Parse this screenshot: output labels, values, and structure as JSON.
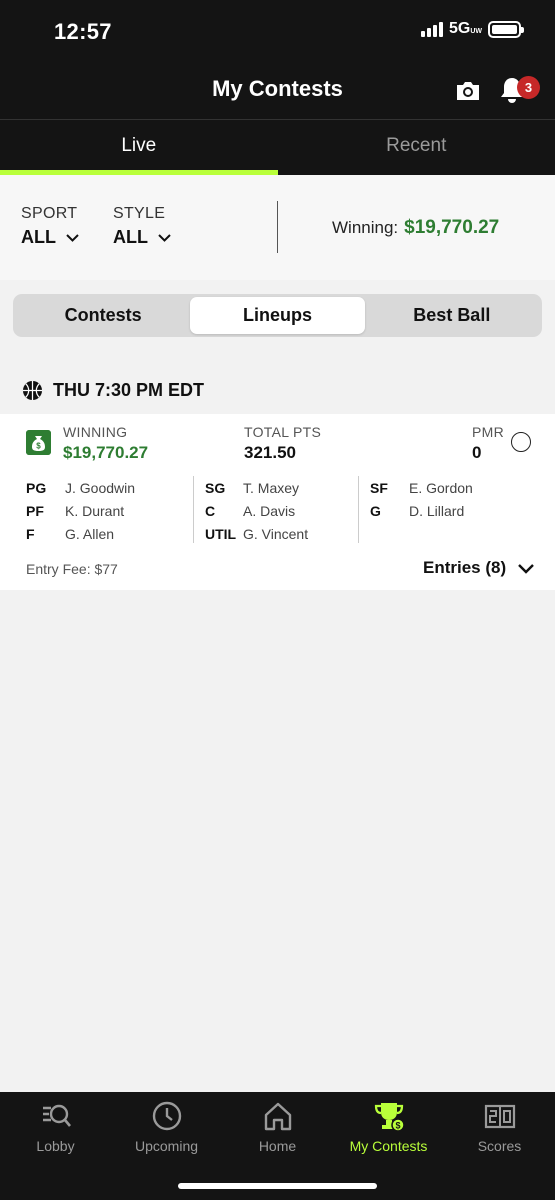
{
  "status": {
    "time": "12:57",
    "network": "5G",
    "network_sub": "UW"
  },
  "header": {
    "title": "My Contests",
    "notification_count": "3"
  },
  "tabs": [
    {
      "label": "Live",
      "active": true
    },
    {
      "label": "Recent",
      "active": false
    }
  ],
  "filters": {
    "sport": {
      "label": "SPORT",
      "value": "ALL"
    },
    "style": {
      "label": "STYLE",
      "value": "ALL"
    },
    "winning_label": "Winning:",
    "winning_value": "$19,770.27"
  },
  "segments": [
    {
      "label": "Contests",
      "active": false
    },
    {
      "label": "Lineups",
      "active": true
    },
    {
      "label": "Best Ball",
      "active": false
    }
  ],
  "slate": {
    "time": "THU 7:30 PM EDT",
    "icon": "basketball-icon"
  },
  "lineup": {
    "winning_label": "WINNING",
    "winning_value": "$19,770.27",
    "total_pts_label": "TOTAL PTS",
    "total_pts_value": "321.50",
    "pmr_label": "PMR",
    "pmr_value": "0",
    "roster": [
      [
        {
          "pos": "PG",
          "name": "J. Goodwin"
        },
        {
          "pos": "PF",
          "name": "K. Durant"
        },
        {
          "pos": "F",
          "name": "G. Allen"
        }
      ],
      [
        {
          "pos": "SG",
          "name": "T. Maxey"
        },
        {
          "pos": "C",
          "name": "A. Davis"
        },
        {
          "pos": "UTIL",
          "name": "G. Vincent"
        }
      ],
      [
        {
          "pos": "SF",
          "name": "E. Gordon"
        },
        {
          "pos": "G",
          "name": "D. Lillard"
        }
      ]
    ],
    "entry_fee": "Entry Fee: $77",
    "entries": "Entries (8)"
  },
  "nav": [
    {
      "label": "Lobby",
      "icon": "lobby-search-icon",
      "active": false
    },
    {
      "label": "Upcoming",
      "icon": "clock-icon",
      "active": false
    },
    {
      "label": "Home",
      "icon": "home-icon",
      "active": false
    },
    {
      "label": "My Contests",
      "icon": "trophy-icon",
      "active": true
    },
    {
      "label": "Scores",
      "icon": "scoreboard-icon",
      "active": false
    }
  ],
  "colors": {
    "accent": "#b9ff3a",
    "winning_green": "#2e7d32",
    "badge_red": "#c62828",
    "chrome": "#141414"
  }
}
